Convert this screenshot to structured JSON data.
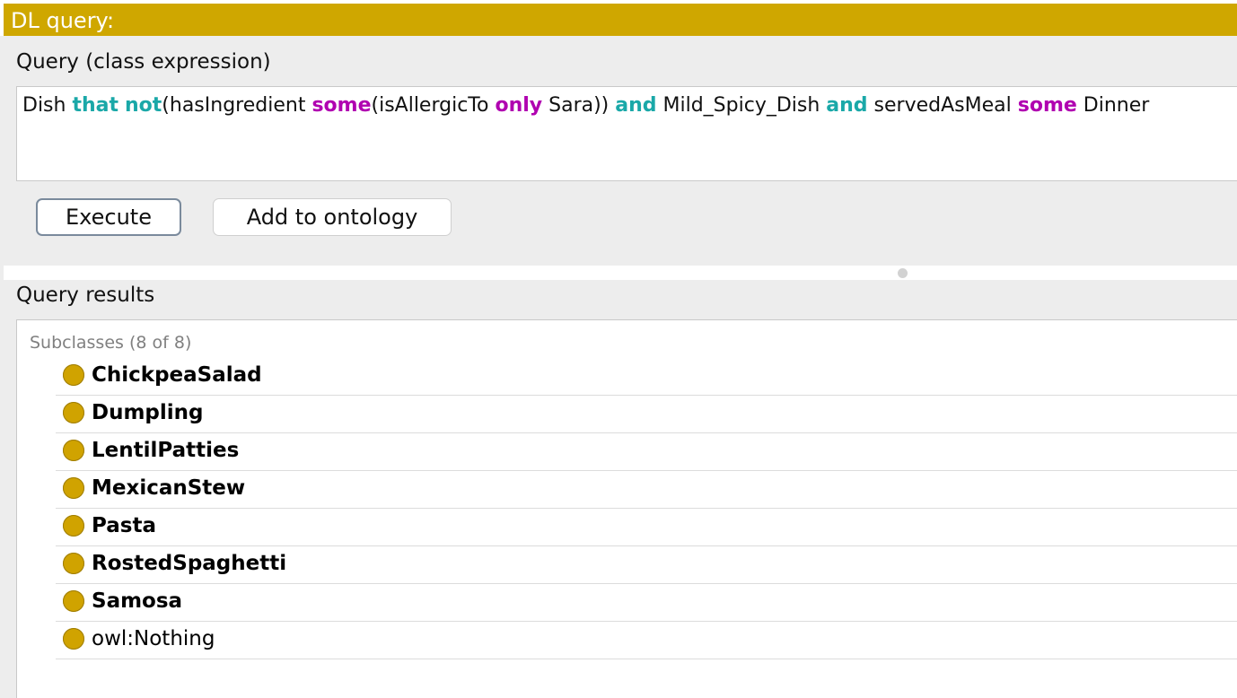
{
  "window": {
    "title": "DL query:"
  },
  "query": {
    "section_label": "Query (class expression)",
    "tokens": [
      {
        "text": "Dish ",
        "kind": "plain"
      },
      {
        "text": "that",
        "kind": "keyword-teal"
      },
      {
        "text": " ",
        "kind": "plain"
      },
      {
        "text": "not",
        "kind": "keyword-teal"
      },
      {
        "text": "(hasIngredient ",
        "kind": "plain"
      },
      {
        "text": "some",
        "kind": "keyword-purple"
      },
      {
        "text": "(isAllergicTo ",
        "kind": "plain"
      },
      {
        "text": "only",
        "kind": "keyword-purple"
      },
      {
        "text": " Sara)) ",
        "kind": "plain"
      },
      {
        "text": "and",
        "kind": "keyword-teal"
      },
      {
        "text": " Mild_Spicy_Dish ",
        "kind": "plain"
      },
      {
        "text": "and",
        "kind": "keyword-teal"
      },
      {
        "text": " servedAsMeal ",
        "kind": "plain"
      },
      {
        "text": "some",
        "kind": "keyword-purple"
      },
      {
        "text": " Dinner",
        "kind": "plain"
      }
    ]
  },
  "buttons": {
    "execute_label": "Execute",
    "add_to_ontology_label": "Add to ontology"
  },
  "results": {
    "section_label": "Query results",
    "subclasses_header": "Subclasses (8 of 8)",
    "items": [
      {
        "label": "ChickpeaSalad",
        "bold": true,
        "icon": "class-circle-icon"
      },
      {
        "label": "Dumpling",
        "bold": true,
        "icon": "class-circle-icon"
      },
      {
        "label": "LentilPatties",
        "bold": true,
        "icon": "class-circle-icon"
      },
      {
        "label": "MexicanStew",
        "bold": true,
        "icon": "class-circle-icon"
      },
      {
        "label": "Pasta",
        "bold": true,
        "icon": "class-circle-icon"
      },
      {
        "label": "RostedSpaghetti",
        "bold": true,
        "icon": "class-circle-icon"
      },
      {
        "label": "Samosa",
        "bold": true,
        "icon": "class-circle-icon"
      },
      {
        "label": "owl:Nothing",
        "bold": false,
        "icon": "class-circle-icon"
      }
    ]
  },
  "colors": {
    "title_bar": "#cfa700",
    "keyword_teal": "#1aa8a8",
    "keyword_purple": "#b000b0",
    "class_icon": "#d0a300"
  }
}
